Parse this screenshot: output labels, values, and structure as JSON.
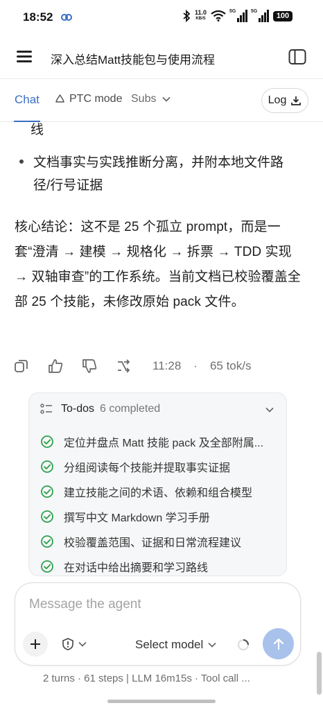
{
  "status_bar": {
    "time": "18:52",
    "net_speed": "11.0",
    "net_unit": "KB/S",
    "signal1": "5G",
    "signal2": "5G",
    "battery": "100"
  },
  "header": {
    "title": "深入总结Matt技能包与使用流程"
  },
  "tabs": {
    "chat": "Chat",
    "ptc": "PTC mode",
    "subs": "Subs",
    "log": "Log"
  },
  "message": {
    "cont_line": "线",
    "bullet": "文档事实与实践推断分离，并附本地文件路径/行号证据",
    "conclusion": "核心结论：这不是 25 个孤立 prompt，而是一套“澄清 → 建模 → 规格化 → 拆票 → TDD 实现 → 双轴审查”的工作系统。当前文档已校验覆盖全部 25 个技能，未修改原始 pack 文件。",
    "time": "11:28",
    "sep": "·",
    "tokens": "65 tok/s"
  },
  "todos": {
    "title": "To-dos",
    "count": "6 completed",
    "items": [
      "定位并盘点 Matt 技能 pack 及全部附属...",
      "分组阅读每个技能并提取事实证据",
      "建立技能之间的术语、依赖和组合模型",
      "撰写中文 Markdown 学习手册",
      "校验覆盖范围、证据和日常流程建议",
      "在对话中给出摘要和学习路线"
    ]
  },
  "composer": {
    "placeholder": "Message the agent",
    "model": "Select model"
  },
  "footer": {
    "text": "2 turns · 61 steps  |  LLM 16m15s · Tool call ..."
  },
  "colors": {
    "accent": "#3a6fc4",
    "check": "#2fa14f",
    "send": "#a8c2ec"
  }
}
